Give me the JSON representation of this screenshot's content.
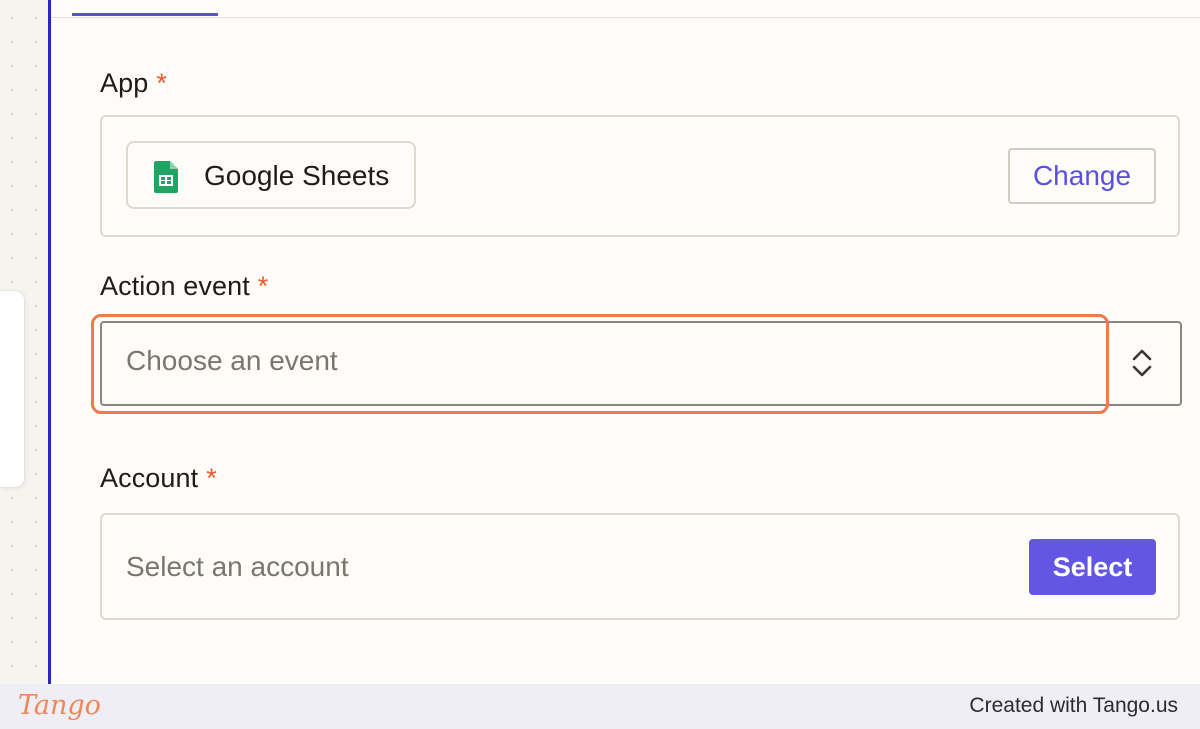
{
  "app_field": {
    "label": "App",
    "required_mark": "*",
    "selected_app": "Google Sheets",
    "app_icon": "google-sheets-icon",
    "change_label": "Change"
  },
  "action_event": {
    "label": "Action event",
    "required_mark": "*",
    "placeholder": "Choose an event",
    "icon": "chevron-up-down-icon"
  },
  "account": {
    "label": "Account",
    "required_mark": "*",
    "placeholder": "Select an account",
    "select_label": "Select"
  },
  "footer": {
    "logo_text": "Tango",
    "credit": "Created with Tango.us"
  },
  "colors": {
    "accent": "#5b4fe0",
    "select_button": "#6356e5",
    "required": "#f0572b",
    "highlight": "#f07a4e",
    "sheets_green": "#1fa463"
  }
}
